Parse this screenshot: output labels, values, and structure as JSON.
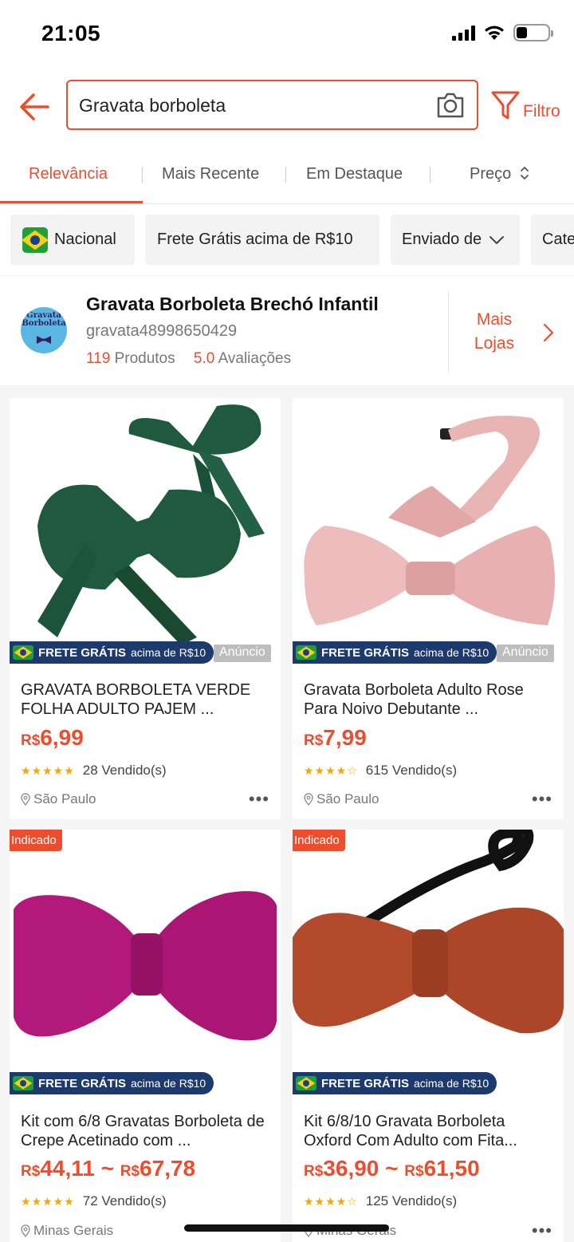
{
  "status_bar": {
    "time": "21:05"
  },
  "search": {
    "query": "Gravata borboleta",
    "filter_label": "Filtro"
  },
  "sort_tabs": [
    {
      "label": "Relevância",
      "active": true
    },
    {
      "label": "Mais Recente"
    },
    {
      "label": "Em Destaque"
    },
    {
      "label": "Preço"
    }
  ],
  "filter_chips": [
    {
      "label": "Nacional"
    },
    {
      "label": "Frete Grátis acima de R$10"
    },
    {
      "label": "Enviado de"
    },
    {
      "label": "Categoria"
    }
  ],
  "shop": {
    "avatar_text_1": "Gravata",
    "avatar_text_2": "Borboleta",
    "name": "Gravata Borboleta Brechó Infantil",
    "handle": "gravata48998650429",
    "products_count": "119",
    "products_label": "Produtos",
    "rating": "5.0",
    "rating_label": "Avaliações",
    "more_label_1": "Mais",
    "more_label_2": "Lojas"
  },
  "badges": {
    "free_shipping_bold": "FRETE GRÁTIS",
    "free_shipping_rest": "acima de R$10",
    "ad": "Anúncio",
    "featured": "Indicado"
  },
  "currency": "R$",
  "products": [
    {
      "title": "GRAVATA BORBOLETA VERDE FOLHA ADULTO PAJEM ...",
      "price": "6,99",
      "stars": "★★★★★",
      "sold": "28 Vendido(s)",
      "location": "São Paulo",
      "color": "#1f5a3f"
    },
    {
      "title": "Gravata Borboleta Adulto Rose Para Noivo Debutante ...",
      "price": "7,99",
      "stars": "★★★★☆",
      "sold": "615 Vendido(s)",
      "location": "São Paulo",
      "color": "#e8aeae"
    },
    {
      "title": "Kit com 6/8 Gravatas Borboleta de Crepe Acetinado com ...",
      "price_min": "44,11",
      "price_max": "67,78",
      "stars": "★★★★★",
      "sold": "72 Vendido(s)",
      "location": "Minas Gerais",
      "color": "#b41a7a"
    },
    {
      "title": "Kit 6/8/10 Gravata Borboleta Oxford Com Adulto com Fita...",
      "price_min": "36,90",
      "price_max": "61,50",
      "stars": "★★★★☆",
      "sold": "125 Vendido(s)",
      "location": "Minas Gerais",
      "color": "#b14a2c"
    }
  ],
  "price_separator": "~",
  "more_dots": "•••"
}
